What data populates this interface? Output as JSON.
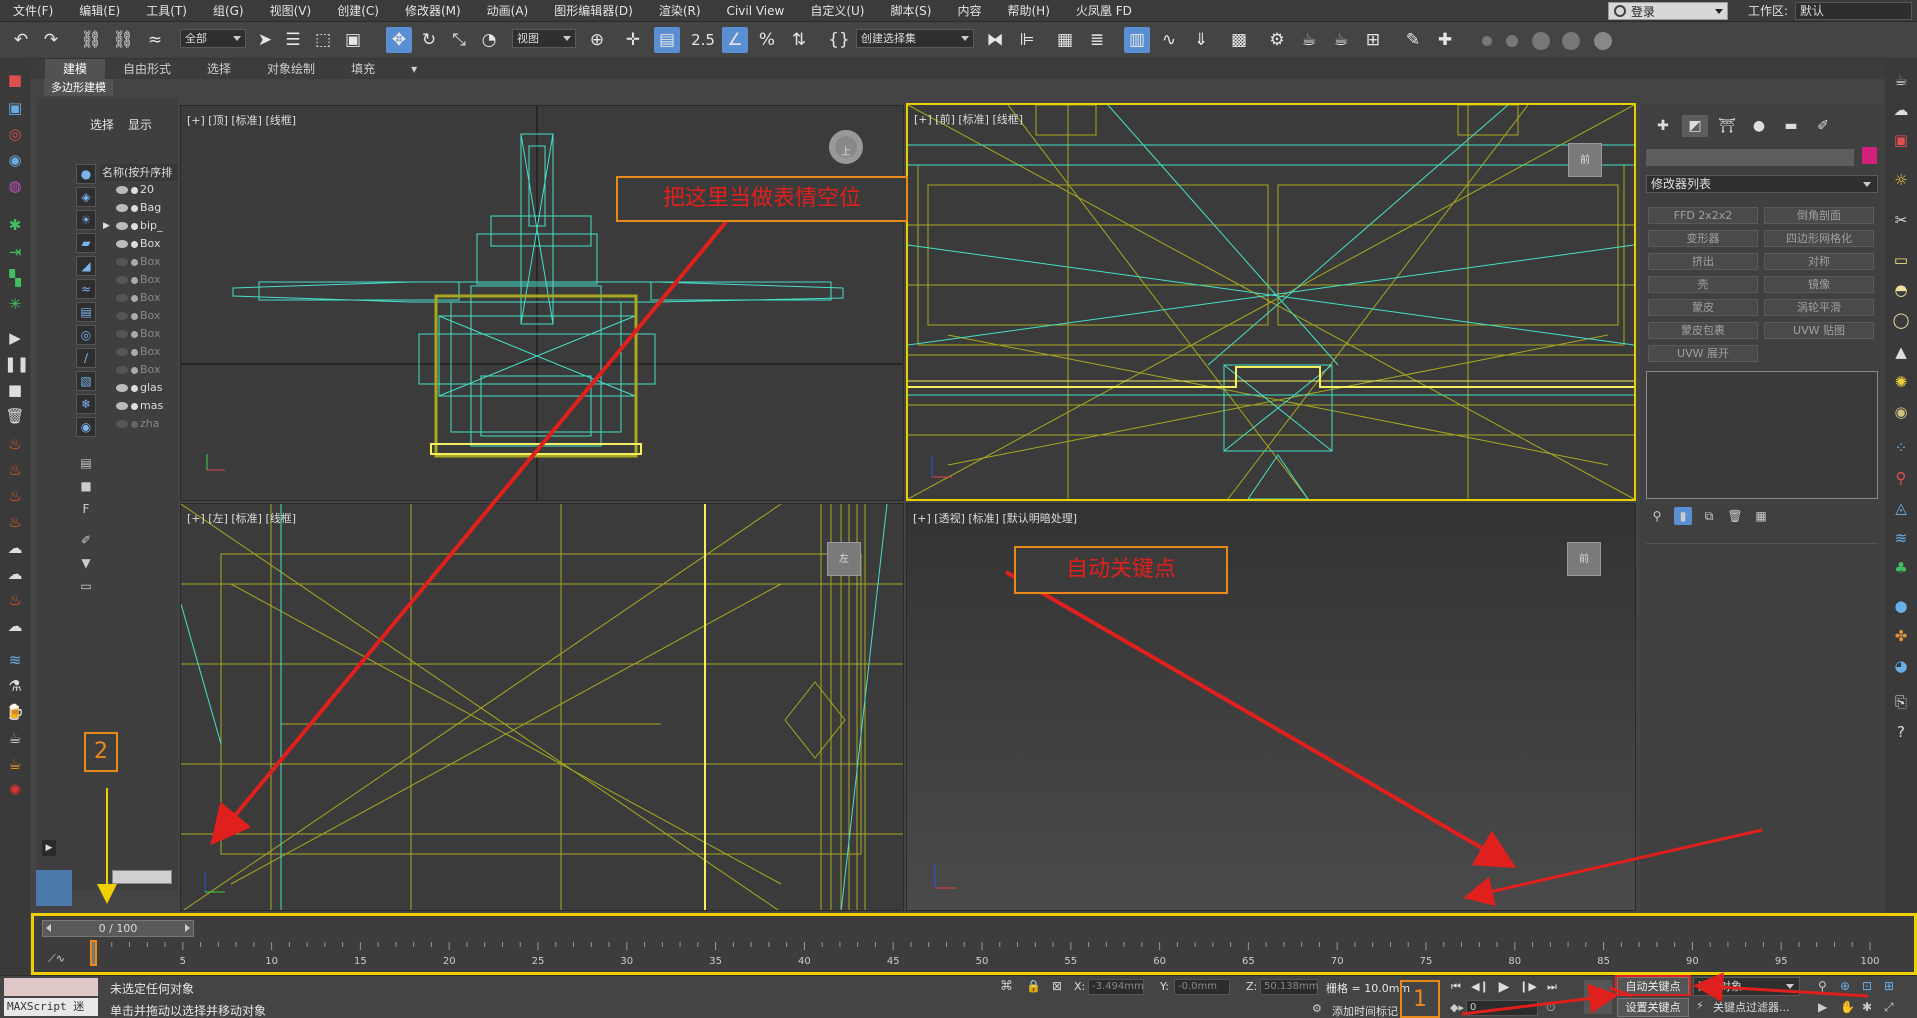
{
  "menu": [
    "文件(F)",
    "编辑(E)",
    "工具(T)",
    "组(G)",
    "视图(V)",
    "创建(C)",
    "修改器(M)",
    "动画(A)",
    "图形编辑器(D)",
    "渲染(R)",
    "Civil View",
    "自定义(U)",
    "脚本(S)",
    "内容",
    "帮助(H)",
    "火凤凰 FD"
  ],
  "login": {
    "label": "登录"
  },
  "workspace": {
    "label": "工作区:",
    "value": "默认"
  },
  "toolbar": {
    "filter": "全部",
    "coord_system": "视图",
    "selection_set": "创建选择集",
    "snap_label": "2.5"
  },
  "ribbon": {
    "tabs": [
      "建模",
      "自由形式",
      "选择",
      "对象绘制",
      "填充"
    ],
    "sub": "多边形建模"
  },
  "explorer": {
    "tabs": [
      "选择",
      "显示"
    ],
    "header": "名称(按升序排",
    "items": [
      "20",
      "Bag",
      "bip_",
      "Box",
      "Box",
      "Box",
      "Box",
      "Box",
      "Box",
      "Box",
      "Box",
      "glas",
      "mas",
      "zha"
    ]
  },
  "viewports": {
    "top": {
      "label": "[+] [顶] [标准] [线框]",
      "cube": "上"
    },
    "front": {
      "label": "[+] [前] [标准] [线框]",
      "cube": "前"
    },
    "left": {
      "label": "[+] [左] [标准] [线框]",
      "cube": "左"
    },
    "persp": {
      "label": "[+] [透视] [标准] [默认明暗处理]",
      "cube": "前"
    }
  },
  "command_panel": {
    "modifier_list": "修改器列表",
    "modifiers": [
      "FFD 2x2x2",
      "倒角剖面",
      "变形器",
      "四边形网格化",
      "挤出",
      "对称",
      "壳",
      "镜像",
      "蒙皮",
      "涡轮平滑",
      "蒙皮包裹",
      "UVW 贴图",
      "UVW 展开"
    ]
  },
  "timeline": {
    "slider": "0 / 100",
    "ticks": [
      "5",
      "10",
      "15",
      "20",
      "25",
      "30",
      "35",
      "40",
      "45",
      "50",
      "55",
      "60",
      "65",
      "70",
      "75",
      "80",
      "85",
      "90",
      "95",
      "100"
    ]
  },
  "status": {
    "maxscript": "MAXScript 迷",
    "line1": "未选定任何对象",
    "line2": "单击并拖动以选择并移动对象",
    "x_label": "X:",
    "x_value": "-3.494mm",
    "y_label": "Y:",
    "y_value": "-0.0mm",
    "z_label": "Z:",
    "z_value": "50.138mm",
    "grid": "栅格 = 10.0mm",
    "add_time_tag": "添加时间标记",
    "auto_key": "自动关键点",
    "set_key": "设置关键点",
    "selected_object": "选定对象",
    "key_filter": "关键点过滤器...",
    "frame": "0"
  },
  "annotations": {
    "note1": "把这里当做表情空位",
    "note2": "自动关键点",
    "num1": "1",
    "num2": "2"
  },
  "colors": {
    "accent": "#5a8fd2",
    "annotation_red": "#e0201c",
    "annotation_orange": "#e88a1a",
    "active_yellow": "#f0d000",
    "wire_cyan": "#46e0c8",
    "wire_olive": "#a8a820"
  }
}
